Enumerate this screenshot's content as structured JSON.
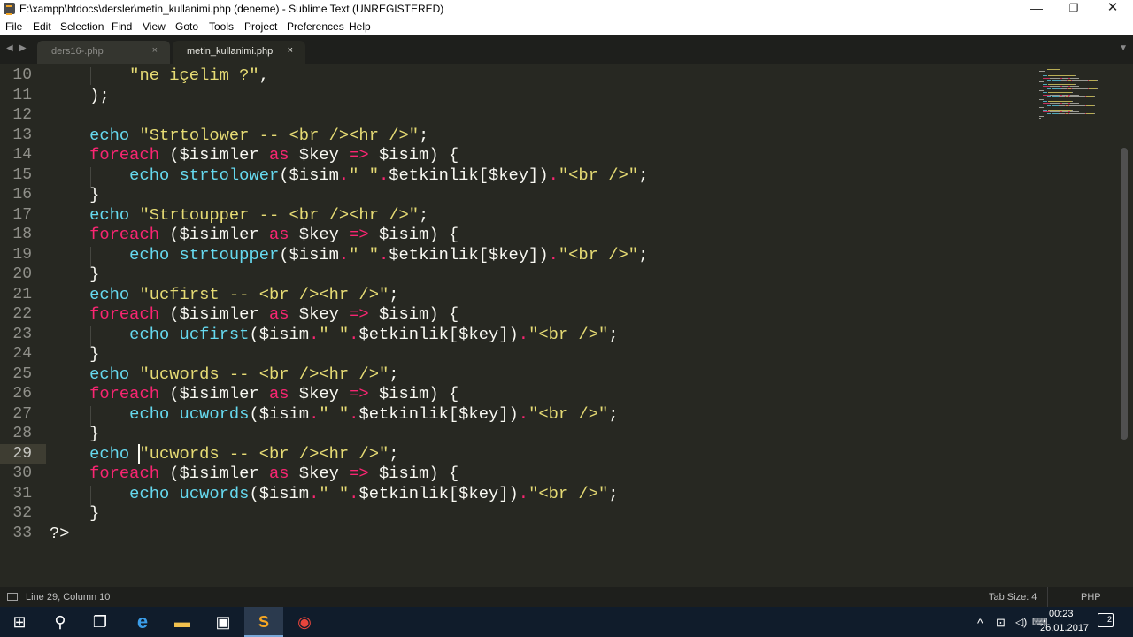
{
  "window": {
    "title": "E:\\xampp\\htdocs\\dersler\\metin_kullanimi.php (deneme) - Sublime Text (UNREGISTERED)",
    "min_glyph": "—",
    "max_glyph": "❐",
    "close_glyph": "✕"
  },
  "menu": [
    {
      "label": "File"
    },
    {
      "label": "Edit"
    },
    {
      "label": "Selection"
    },
    {
      "label": "Find"
    },
    {
      "label": "View"
    },
    {
      "label": "Goto"
    },
    {
      "label": "Tools"
    },
    {
      "label": "Project"
    },
    {
      "label": "Preferences"
    },
    {
      "label": "Help"
    }
  ],
  "tabs": [
    {
      "label": "ders16-.php",
      "active": false,
      "close": "×"
    },
    {
      "label": "metin_kullanimi.php",
      "active": true,
      "close": "×"
    }
  ],
  "tab_nav": {
    "left": "◀",
    "right": "▶",
    "dropdown": "▼"
  },
  "editor": {
    "current_line": 29,
    "lines": [
      {
        "num": "10",
        "tokens": [
          [
            "t",
            "        "
          ],
          [
            "str",
            "\"ne içelim ?\""
          ],
          [
            "t",
            ","
          ]
        ]
      },
      {
        "num": "11",
        "tokens": [
          [
            "t",
            "    );"
          ]
        ]
      },
      {
        "num": "12",
        "tokens": []
      },
      {
        "num": "13",
        "tokens": [
          [
            "t",
            "    "
          ],
          [
            "kw",
            "echo"
          ],
          [
            "t",
            " "
          ],
          [
            "str",
            "\"Strtolower -- <br /><hr />\""
          ],
          [
            "t",
            ";"
          ]
        ]
      },
      {
        "num": "14",
        "tokens": [
          [
            "t",
            "    "
          ],
          [
            "ctrl",
            "foreach"
          ],
          [
            "t",
            " ($isimler "
          ],
          [
            "ctrl",
            "as"
          ],
          [
            "t",
            " $key "
          ],
          [
            "ctrl",
            "=>"
          ],
          [
            "t",
            " $isim) {"
          ]
        ]
      },
      {
        "num": "15",
        "tokens": [
          [
            "t",
            "        "
          ],
          [
            "kw",
            "echo"
          ],
          [
            "t",
            " "
          ],
          [
            "fn",
            "strtolower"
          ],
          [
            "t",
            "($isim"
          ],
          [
            "ctrl",
            "."
          ],
          [
            "str",
            "\" \""
          ],
          [
            "ctrl",
            "."
          ],
          [
            "t",
            "$etkinlik[$key])"
          ],
          [
            "ctrl",
            "."
          ],
          [
            "str",
            "\"<br />\""
          ],
          [
            "t",
            ";"
          ]
        ]
      },
      {
        "num": "16",
        "tokens": [
          [
            "t",
            "    }"
          ]
        ]
      },
      {
        "num": "17",
        "tokens": [
          [
            "t",
            "    "
          ],
          [
            "kw",
            "echo"
          ],
          [
            "t",
            " "
          ],
          [
            "str",
            "\"Strtoupper -- <br /><hr />\""
          ],
          [
            "t",
            ";"
          ]
        ]
      },
      {
        "num": "18",
        "tokens": [
          [
            "t",
            "    "
          ],
          [
            "ctrl",
            "foreach"
          ],
          [
            "t",
            " ($isimler "
          ],
          [
            "ctrl",
            "as"
          ],
          [
            "t",
            " $key "
          ],
          [
            "ctrl",
            "=>"
          ],
          [
            "t",
            " $isim) {"
          ]
        ]
      },
      {
        "num": "19",
        "tokens": [
          [
            "t",
            "        "
          ],
          [
            "kw",
            "echo"
          ],
          [
            "t",
            " "
          ],
          [
            "fn",
            "strtoupper"
          ],
          [
            "t",
            "($isim"
          ],
          [
            "ctrl",
            "."
          ],
          [
            "str",
            "\" \""
          ],
          [
            "ctrl",
            "."
          ],
          [
            "t",
            "$etkinlik[$key])"
          ],
          [
            "ctrl",
            "."
          ],
          [
            "str",
            "\"<br />\""
          ],
          [
            "t",
            ";"
          ]
        ]
      },
      {
        "num": "20",
        "tokens": [
          [
            "t",
            "    }"
          ]
        ]
      },
      {
        "num": "21",
        "tokens": [
          [
            "t",
            "    "
          ],
          [
            "kw",
            "echo"
          ],
          [
            "t",
            " "
          ],
          [
            "str",
            "\"ucfirst -- <br /><hr />\""
          ],
          [
            "t",
            ";"
          ]
        ]
      },
      {
        "num": "22",
        "tokens": [
          [
            "t",
            "    "
          ],
          [
            "ctrl",
            "foreach"
          ],
          [
            "t",
            " ($isimler "
          ],
          [
            "ctrl",
            "as"
          ],
          [
            "t",
            " $key "
          ],
          [
            "ctrl",
            "=>"
          ],
          [
            "t",
            " $isim) {"
          ]
        ]
      },
      {
        "num": "23",
        "tokens": [
          [
            "t",
            "        "
          ],
          [
            "kw",
            "echo"
          ],
          [
            "t",
            " "
          ],
          [
            "fn",
            "ucfirst"
          ],
          [
            "t",
            "($isim"
          ],
          [
            "ctrl",
            "."
          ],
          [
            "str",
            "\" \""
          ],
          [
            "ctrl",
            "."
          ],
          [
            "t",
            "$etkinlik[$key])"
          ],
          [
            "ctrl",
            "."
          ],
          [
            "str",
            "\"<br />\""
          ],
          [
            "t",
            ";"
          ]
        ]
      },
      {
        "num": "24",
        "tokens": [
          [
            "t",
            "    }"
          ]
        ]
      },
      {
        "num": "25",
        "tokens": [
          [
            "t",
            "    "
          ],
          [
            "kw",
            "echo"
          ],
          [
            "t",
            " "
          ],
          [
            "str",
            "\"ucwords -- <br /><hr />\""
          ],
          [
            "t",
            ";"
          ]
        ]
      },
      {
        "num": "26",
        "tokens": [
          [
            "t",
            "    "
          ],
          [
            "ctrl",
            "foreach"
          ],
          [
            "t",
            " ($isimler "
          ],
          [
            "ctrl",
            "as"
          ],
          [
            "t",
            " $key "
          ],
          [
            "ctrl",
            "=>"
          ],
          [
            "t",
            " $isim) {"
          ]
        ]
      },
      {
        "num": "27",
        "tokens": [
          [
            "t",
            "        "
          ],
          [
            "kw",
            "echo"
          ],
          [
            "t",
            " "
          ],
          [
            "fn",
            "ucwords"
          ],
          [
            "t",
            "($isim"
          ],
          [
            "ctrl",
            "."
          ],
          [
            "str",
            "\" \""
          ],
          [
            "ctrl",
            "."
          ],
          [
            "t",
            "$etkinlik[$key])"
          ],
          [
            "ctrl",
            "."
          ],
          [
            "str",
            "\"<br />\""
          ],
          [
            "t",
            ";"
          ]
        ]
      },
      {
        "num": "28",
        "tokens": [
          [
            "t",
            "    }"
          ]
        ]
      },
      {
        "num": "29",
        "tokens": [
          [
            "t",
            "    "
          ],
          [
            "kw",
            "echo"
          ],
          [
            "t",
            " "
          ],
          [
            "str",
            "\"ucwords -- <br /><hr />\""
          ],
          [
            "t",
            ";"
          ]
        ]
      },
      {
        "num": "30",
        "tokens": [
          [
            "t",
            "    "
          ],
          [
            "ctrl",
            "foreach"
          ],
          [
            "t",
            " ($isimler "
          ],
          [
            "ctrl",
            "as"
          ],
          [
            "t",
            " $key "
          ],
          [
            "ctrl",
            "=>"
          ],
          [
            "t",
            " $isim) {"
          ]
        ]
      },
      {
        "num": "31",
        "tokens": [
          [
            "t",
            "        "
          ],
          [
            "kw",
            "echo"
          ],
          [
            "t",
            " "
          ],
          [
            "fn",
            "ucwords"
          ],
          [
            "t",
            "($isim"
          ],
          [
            "ctrl",
            "."
          ],
          [
            "str",
            "\" \""
          ],
          [
            "ctrl",
            "."
          ],
          [
            "t",
            "$etkinlik[$key])"
          ],
          [
            "ctrl",
            "."
          ],
          [
            "str",
            "\"<br />\""
          ],
          [
            "t",
            ";"
          ]
        ]
      },
      {
        "num": "32",
        "tokens": [
          [
            "t",
            "    }"
          ]
        ]
      },
      {
        "num": "33",
        "tokens": [
          [
            "t",
            "?>"
          ]
        ]
      }
    ]
  },
  "status": {
    "position": "Line 29, Column 10",
    "tab_size": "Tab Size: 4",
    "syntax": "PHP"
  },
  "taskbar": {
    "time": "00:23",
    "date": "26.01.2017",
    "notification_count": "2",
    "start_glyph": "⊞",
    "search_glyph": "⚲",
    "taskview_glyph": "❐",
    "edge_glyph": "e",
    "explorer_glyph": "▬",
    "store_glyph": "▣",
    "sublime_glyph": "S",
    "chrome_glyph": "◉",
    "tray_up": "^",
    "tray_network": "⊡",
    "tray_volume": "◁)",
    "tray_keyboard": "⌨"
  },
  "colors": {
    "keyword": "#66d9ef",
    "control": "#f92672",
    "string": "#e6db74",
    "text": "#f8f8f2",
    "background": "#272822"
  }
}
